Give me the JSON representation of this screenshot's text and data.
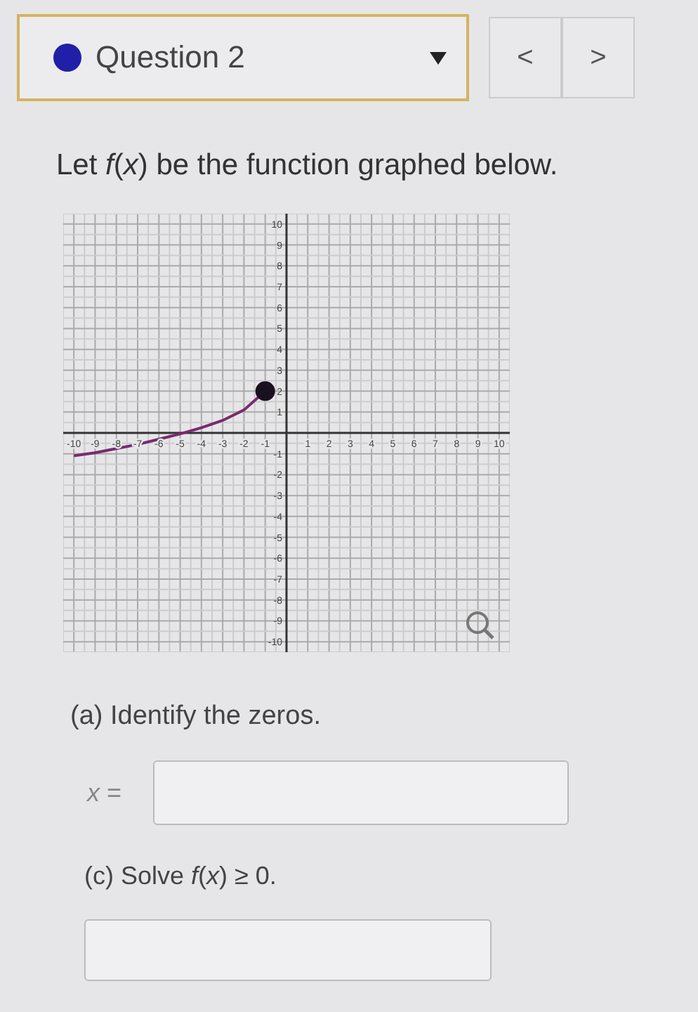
{
  "question_selector": {
    "label": "Question 2"
  },
  "nav_buttons": [
    {
      "label": "<"
    },
    {
      "label": ">"
    }
  ],
  "prompt": "Let *f*(*x*) be the function graphed below.",
  "graph": {
    "chart_data": {
      "type": "line",
      "grid": true,
      "x": [
        -10,
        -9,
        -8,
        -7,
        -6,
        -5,
        -4,
        -3,
        -2,
        -1
      ],
      "series": [
        {
          "color": "#7a2a6e",
          "values": [
            -1.1,
            -0.95,
            -0.75,
            -0.55,
            -0.3,
            -0.05,
            0.25,
            0.6,
            1.1,
            2
          ]
        }
      ],
      "xlim": [
        -10.5,
        10.5
      ],
      "ylim": [
        -10.5,
        10.5
      ],
      "xticks": [
        -10,
        -9,
        -8,
        -7,
        -6,
        -5,
        -4,
        -3,
        -2,
        -1,
        1,
        2,
        3,
        4,
        5,
        6,
        7,
        8,
        9,
        10
      ],
      "yticks": [
        -10,
        -9,
        -8,
        -7,
        -6,
        -5,
        -4,
        -3,
        -2,
        -1,
        1,
        2,
        3,
        4,
        5,
        6,
        7,
        8,
        9,
        10
      ]
    }
  },
  "part_a": {
    "label": "(a) Identify the zeros.",
    "field_label": "*x* ="
  },
  "part_c": {
    "label": "(c) Solve *f*(*x*) ≥ 0."
  }
}
